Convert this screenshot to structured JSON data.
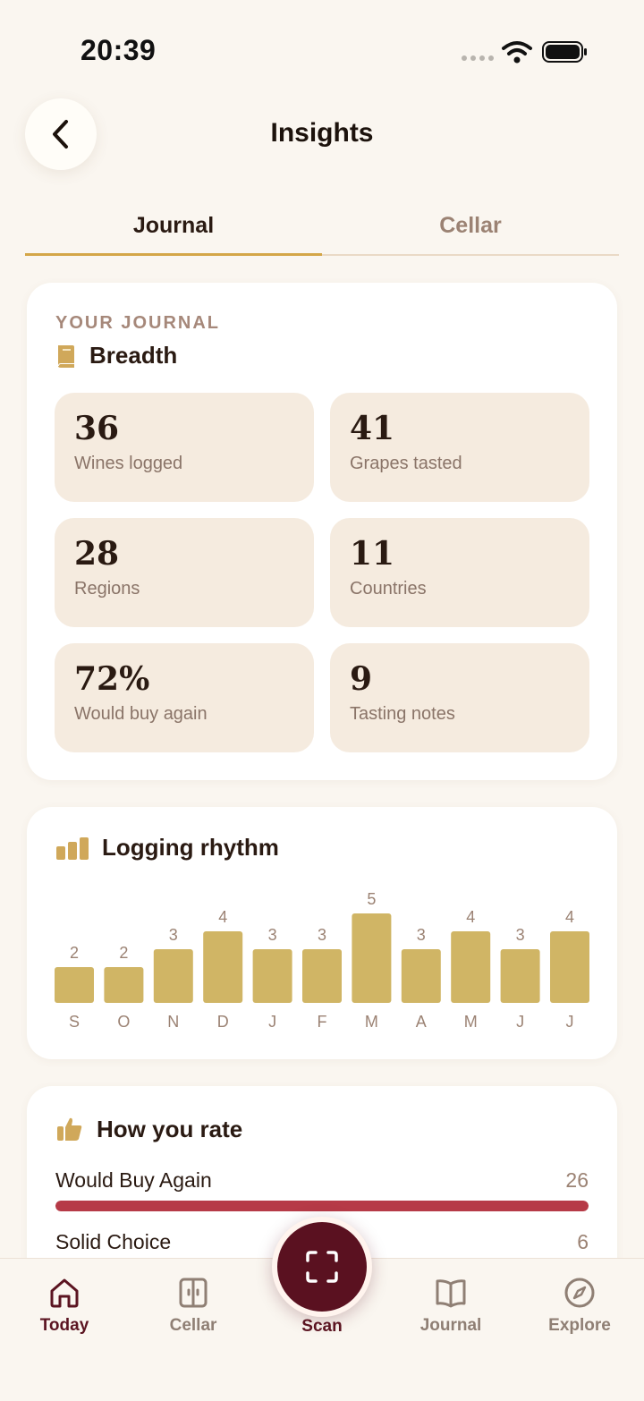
{
  "status_bar": {
    "time": "20:39"
  },
  "header": {
    "title": "Insights"
  },
  "tabs": [
    {
      "label": "Journal",
      "active": true
    },
    {
      "label": "Cellar",
      "active": false
    }
  ],
  "journal_card": {
    "eyebrow": "YOUR JOURNAL",
    "section_title": "Breadth",
    "stats": [
      {
        "value": "36",
        "label": "Wines logged"
      },
      {
        "value": "41",
        "label": "Grapes tasted"
      },
      {
        "value": "28",
        "label": "Regions"
      },
      {
        "value": "11",
        "label": "Countries"
      },
      {
        "value": "72%",
        "label": "Would buy again"
      },
      {
        "value": "9",
        "label": "Tasting notes"
      }
    ]
  },
  "rhythm_card": {
    "title": "Logging rhythm"
  },
  "chart_data": {
    "type": "bar",
    "categories": [
      "S",
      "O",
      "N",
      "D",
      "J",
      "F",
      "M",
      "A",
      "M",
      "J",
      "J"
    ],
    "values": [
      2,
      2,
      3,
      4,
      3,
      3,
      5,
      3,
      4,
      3,
      4
    ],
    "title": "Logging rhythm",
    "xlabel": "",
    "ylabel": "",
    "ylim": [
      0,
      5
    ],
    "grid": false,
    "color": "#d0b565"
  },
  "rate_card": {
    "title": "How you rate",
    "rows": [
      {
        "label": "Would Buy Again",
        "count": "26",
        "fraction": 1.0
      },
      {
        "label": "Solid Choice",
        "count": "6",
        "fraction": 0.23
      }
    ]
  },
  "nav": {
    "items": [
      {
        "label": "Today",
        "icon": "home-icon",
        "active": true
      },
      {
        "label": "Cellar",
        "icon": "cellar-icon",
        "active": false
      },
      {
        "label": "Scan",
        "icon": "scan-icon",
        "active": false
      },
      {
        "label": "Journal",
        "icon": "book-open-icon",
        "active": false
      },
      {
        "label": "Explore",
        "icon": "compass-icon",
        "active": false
      }
    ]
  },
  "colors": {
    "background": "#faf6f0",
    "accent_gold": "#d4a648",
    "bar_gold": "#d0b565",
    "wine": "#5a1120",
    "rating_red": "#b63a47",
    "tile": "#f5ebdf"
  }
}
